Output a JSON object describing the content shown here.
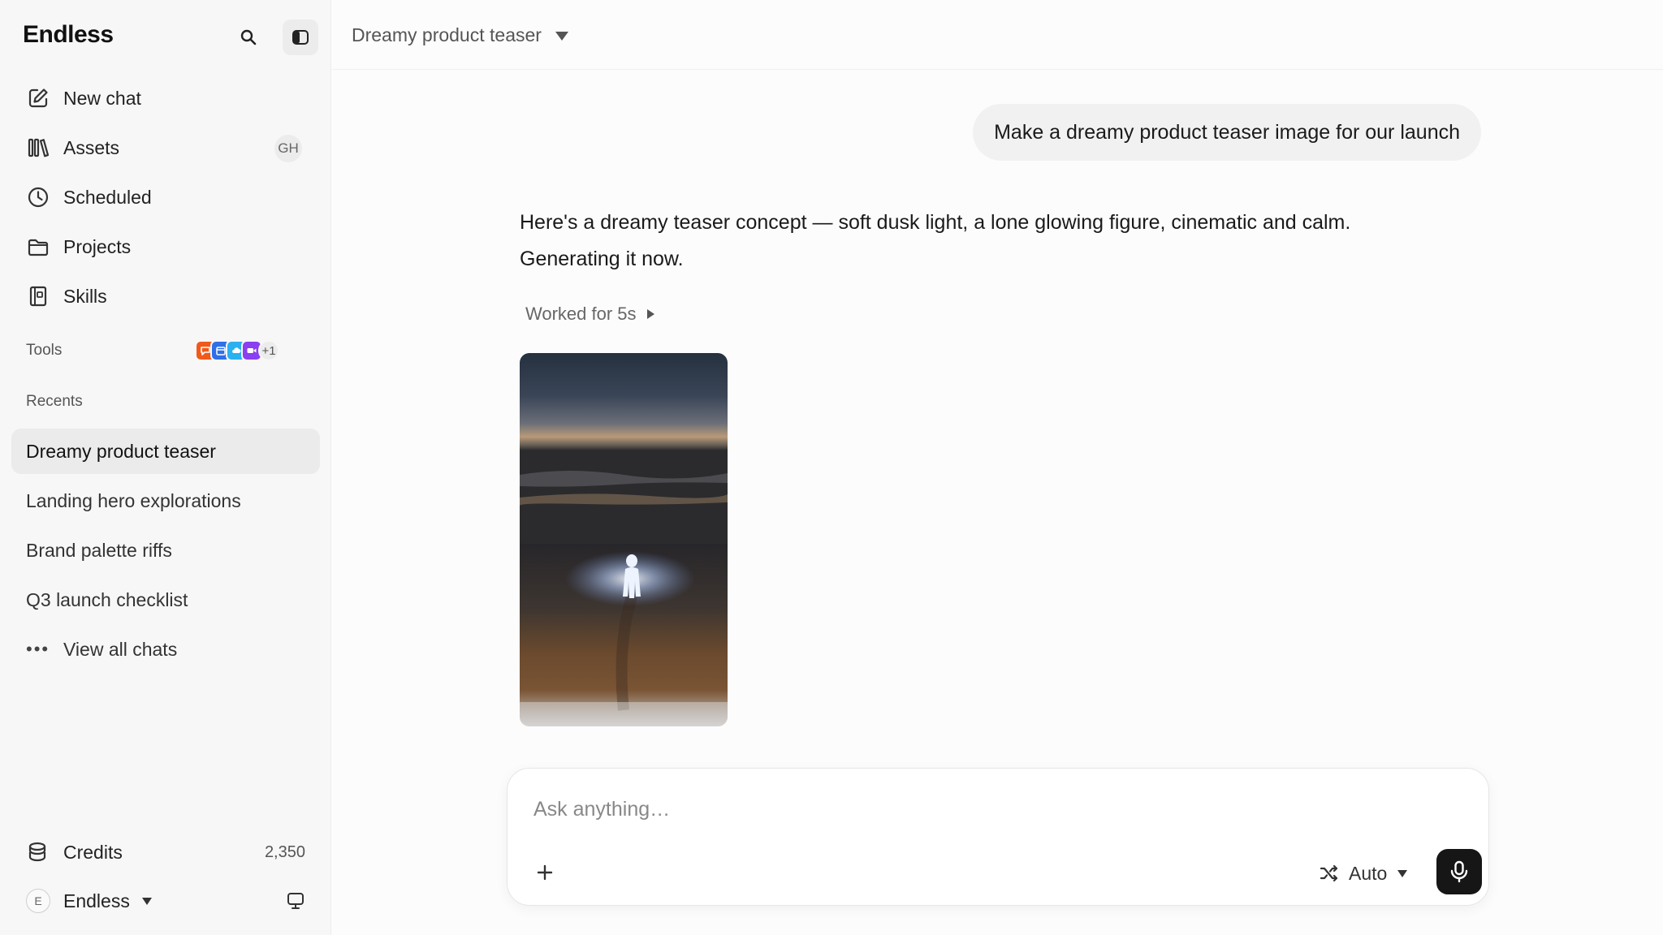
{
  "sidebar": {
    "brand": "Endless",
    "nav": [
      {
        "label": "New chat",
        "icon": "edit-icon"
      },
      {
        "label": "Assets",
        "icon": "library-icon",
        "badge": "GH"
      },
      {
        "label": "Scheduled",
        "icon": "clock-icon"
      },
      {
        "label": "Projects",
        "icon": "folder-icon"
      },
      {
        "label": "Skills",
        "icon": "book-icon"
      }
    ],
    "tools_label": "Tools",
    "tools_extra_count": "+1",
    "recents_label": "Recents",
    "recents": [
      {
        "label": "Dreamy product teaser",
        "active": true
      },
      {
        "label": "Landing hero explorations"
      },
      {
        "label": "Brand palette riffs"
      },
      {
        "label": "Q3 launch checklist"
      }
    ],
    "view_all_label": "View all chats",
    "credits_label": "Credits",
    "credits_value": "2,350",
    "workspace_avatar": "E",
    "workspace_name": "Endless"
  },
  "header": {
    "chat_title": "Dreamy product teaser"
  },
  "conversation": {
    "user_message": "Make a dreamy product teaser image for our launch",
    "assistant_line1": "Here's a dreamy teaser concept — soft dusk light, a lone glowing figure, cinematic and calm.",
    "assistant_line2": "Generating it now.",
    "worked_label": "Worked for 5s"
  },
  "composer": {
    "placeholder": "Ask anything…",
    "model_label": "Auto"
  },
  "colors": {
    "sidebar_bg": "#f7f7f7",
    "active_item_bg": "#ebebeb",
    "mic_button_bg": "#161616",
    "tool_orange": "#f05a1a",
    "tool_blue": "#2f6fe8",
    "tool_skyblue": "#2bb0f0",
    "tool_purple": "#8a3ff0"
  }
}
